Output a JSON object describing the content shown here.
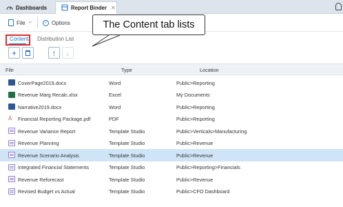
{
  "tabs": [
    {
      "label": "Dashboards",
      "icon": "dashboard-icon"
    },
    {
      "label": "Report Binder",
      "icon": "binder-icon"
    }
  ],
  "toolbar": {
    "file_label": "File",
    "options_label": "Options"
  },
  "subtabs": {
    "content": "Content",
    "distribution": "Distribution List"
  },
  "table": {
    "columns": [
      "File",
      "Type",
      "Location"
    ],
    "rows": [
      {
        "name": "CoverPage2019.docx",
        "type": "Word",
        "location": "Public>Reporting",
        "icon": "word"
      },
      {
        "name": "Revenue Marg Recalc.xlsx",
        "type": "Excel",
        "location": "My Documents",
        "icon": "excel"
      },
      {
        "name": "Narrative2019.docx",
        "type": "Word",
        "location": "Public>Reporting",
        "icon": "word"
      },
      {
        "name": "Financial Reporting Package.pdf",
        "type": "PDF",
        "location": "Public>Reporting",
        "icon": "pdf"
      },
      {
        "name": "Revenue Variance Report",
        "type": "Template Studio",
        "location": "Public>Verticals>Manufacturing",
        "icon": "ts"
      },
      {
        "name": "Revenue Planning",
        "type": "Template Studio",
        "location": "Public>Revenue",
        "icon": "ts"
      },
      {
        "name": "Revenue Scenario Analysis",
        "type": "Template Studio",
        "location": "Public>Revenue",
        "icon": "ts",
        "selected": true
      },
      {
        "name": "Integrated Financial Statements",
        "type": "Template Studio",
        "location": "Public>Reporting>Financials",
        "icon": "ts"
      },
      {
        "name": "Revenue Reforecast",
        "type": "Template Studio",
        "location": "Public>Revenue",
        "icon": "ts"
      },
      {
        "name": "Revised Budget vs Actual",
        "type": "Template Studio",
        "location": "Public>CFO Dashboard",
        "icon": "ts"
      }
    ]
  },
  "callout": {
    "text": "The Content tab lists"
  },
  "colors": {
    "accent": "#1a73c9",
    "highlight_box": "#e12b2b",
    "selected_row": "#cfe5f7"
  }
}
